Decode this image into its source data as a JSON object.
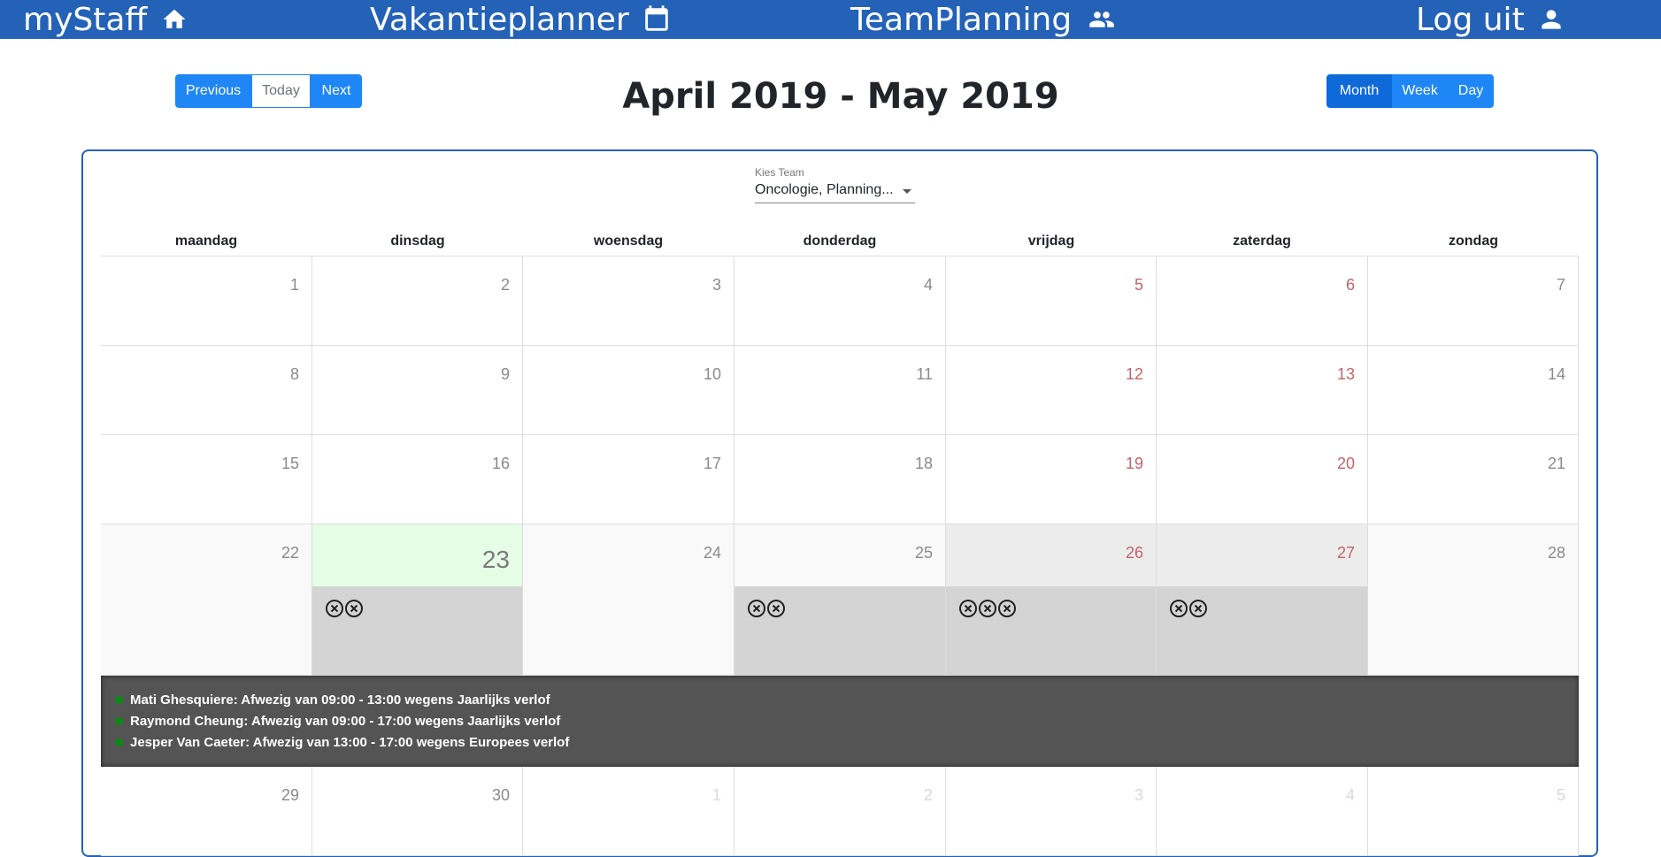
{
  "nav": {
    "home": "myStaff",
    "vacation": "Vakantieplanner",
    "team": "TeamPlanning",
    "logout": "Log uit"
  },
  "toolbar": {
    "previous": "Previous",
    "today": "Today",
    "next": "Next",
    "month": "Month",
    "week": "Week",
    "day": "Day"
  },
  "title": "April 2019 - May 2019",
  "team_select": {
    "label": "Kies Team",
    "value": "Oncologie, Planning..."
  },
  "weekdays": [
    "maandag",
    "dinsdag",
    "woensdag",
    "donderdag",
    "vrijdag",
    "zaterdag",
    "zondag"
  ],
  "weeks": [
    [
      "1",
      "2",
      "3",
      "4",
      "5",
      "6",
      "7"
    ],
    [
      "8",
      "9",
      "10",
      "11",
      "12",
      "13",
      "14"
    ],
    [
      "15",
      "16",
      "17",
      "18",
      "19",
      "20",
      "21"
    ],
    [
      "22",
      "23",
      "24",
      "25",
      "26",
      "27",
      "28"
    ],
    [
      "29",
      "30",
      "1",
      "2",
      "3",
      "4",
      "5"
    ]
  ],
  "event_details": [
    "Mati Ghesquiere: Afwezig van 09:00 - 13:00 wegens Jaarlijks verlof",
    "Raymond Cheung: Afwezig van 09:00 - 17:00 wegens Jaarlijks verlof",
    "Jesper Van Caeter: Afwezig van 13:00 - 17:00 wegens Europees verlof"
  ],
  "colors": {
    "nav_bg": "#2462b8",
    "button_blue": "#1f86f5",
    "today_bg": "#e5fde5",
    "event_bg": "#d4d4d4",
    "detail_bg": "#545454",
    "weekend_text": "#c0646b",
    "status_dot": "#0a8a12"
  },
  "icons": [
    "home-icon",
    "calendar-icon",
    "people-icon",
    "person-icon",
    "cancel-circle-icon"
  ]
}
